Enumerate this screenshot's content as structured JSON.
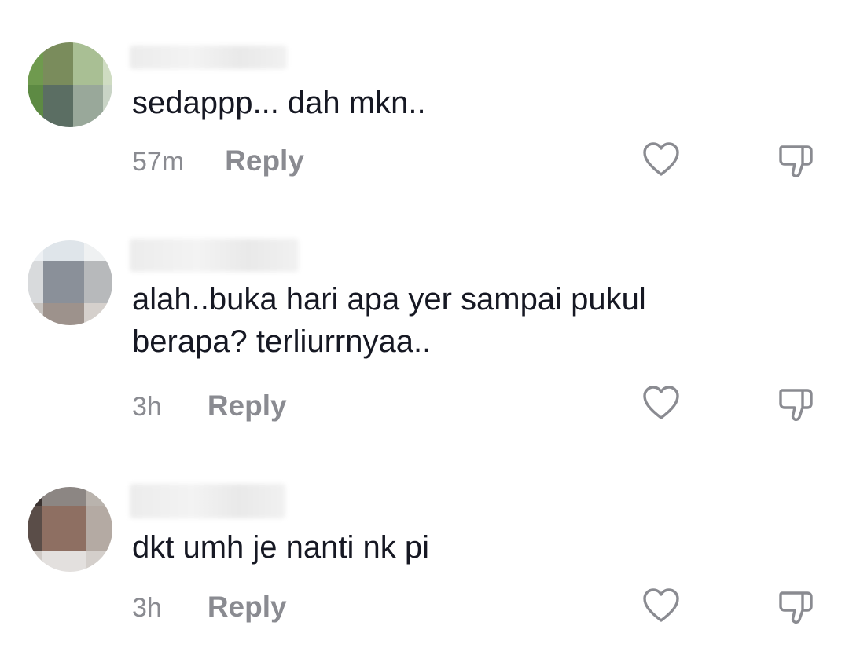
{
  "comments": [
    {
      "text": "sedappp... dah mkn..",
      "time": "57m",
      "reply_label": "Reply"
    },
    {
      "text_line1": "alah..buka hari apa yer sampai pukul",
      "text_line2": "berapa? terliurrnyaa..",
      "time": "3h",
      "reply_label": "Reply"
    },
    {
      "text": "dkt umh je nanti nk pi",
      "time": "3h",
      "reply_label": "Reply"
    }
  ],
  "icons": {
    "like": "heart-outline-icon",
    "dislike": "thumbs-down-outline-icon"
  },
  "colors": {
    "text": "#161823",
    "secondary": "#8a8b91",
    "background": "#ffffff"
  }
}
